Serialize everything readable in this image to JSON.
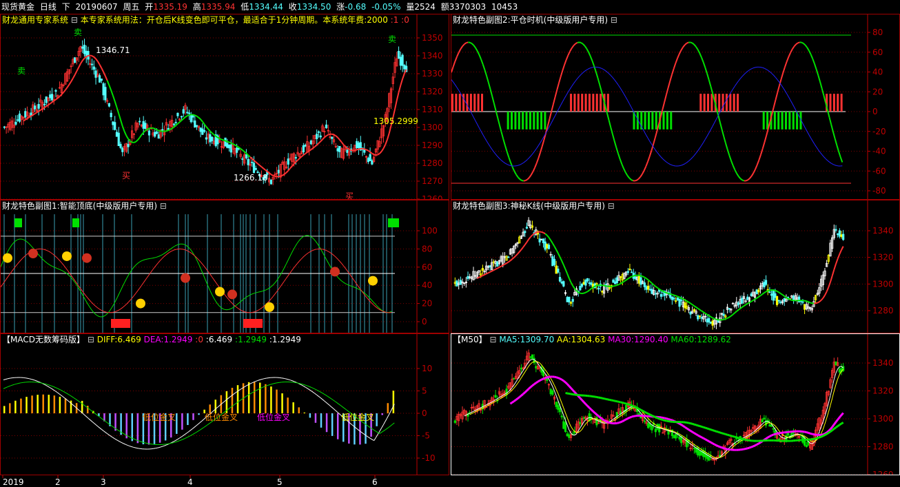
{
  "header": {
    "symbol": "现货黄金",
    "period": "日线",
    "mode": "下",
    "date": "20190607",
    "weekday": "周五",
    "open_label": "开",
    "open": "1335.19",
    "high_label": "高",
    "high": "1335.94",
    "low_label": "低",
    "low": "1334.44",
    "close_label": "收",
    "close": "1334.50",
    "change_label": "涨",
    "change": "-0.68",
    "pct": "-0.05%",
    "vol_label": "量",
    "vol": "2524",
    "amt_label": "额",
    "amt": "3370303",
    "extra": "10453"
  },
  "panel_main": {
    "title": "财龙通用专家系统",
    "collapse": "⊟",
    "desc": "本专家系统用法：开仓后K线变色即可平仓，最适合于1分钟周期。本系统年费:2000",
    "p1": ":1",
    "p2": ":0",
    "y_ticks": [
      "1350",
      "1340",
      "1330",
      "1320",
      "1310",
      "1300",
      "1290",
      "1280",
      "1270",
      "1260"
    ],
    "high_mark": "1346.71",
    "low_mark": "1266.18",
    "last_mark": "1305.2999",
    "sell": "卖",
    "buy": "买"
  },
  "panel_sub1": {
    "title": "财龙特色副图1:智能顶底(中级版用户专用)",
    "collapse": "⊟",
    "y_ticks": [
      "100",
      "80",
      "60",
      "40",
      "20",
      "0"
    ]
  },
  "panel_sub2": {
    "title": "财龙特色副图2:平仓时机(中级版用户专用)",
    "collapse": "⊟",
    "y_ticks": [
      "80",
      "60",
      "40",
      "20",
      "0",
      "-20",
      "-40",
      "-60",
      "-80"
    ]
  },
  "panel_sub3": {
    "title": "财龙特色副图3:神秘K线(中级版用户专用)",
    "collapse": "⊟",
    "y_ticks": [
      "1340",
      "1320",
      "1300",
      "1280"
    ]
  },
  "panel_macd": {
    "title": "【MACD无数筹码版】",
    "collapse": "⊟",
    "diff_label": "DIFF:6.469",
    "dea_label": "DEA:1.2949",
    "v0": ":0",
    "v1": ":6.469",
    "v2": ":1.2949",
    "v3": ":1.2949",
    "y_ticks": [
      "10",
      "5",
      "0",
      "-5",
      "-10"
    ],
    "cross_label": "低位金叉",
    "cross_label2": "低位金叉"
  },
  "panel_ma": {
    "title": "【M50】",
    "collapse": "⊟",
    "ma5": "MA5:1309.70",
    "aa": "AA:1304.63",
    "ma30": "MA30:1290.40",
    "ma60": "MA60:1289.62",
    "y_ticks": [
      "1340",
      "1320",
      "1300",
      "1280",
      "1260"
    ]
  },
  "x_axis": {
    "labels": [
      "2019",
      "2",
      "3",
      "4",
      "5",
      "6"
    ]
  },
  "colors": {
    "up": "#ff3232",
    "down": "#54ffff",
    "grid": "#800000",
    "axis": "#c00000",
    "text": "#c0c0c0",
    "green": "#00e000",
    "yellow": "#ffff00",
    "magenta": "#ff00ff",
    "white": "#ffffff",
    "orange": "#ff8c00"
  }
}
